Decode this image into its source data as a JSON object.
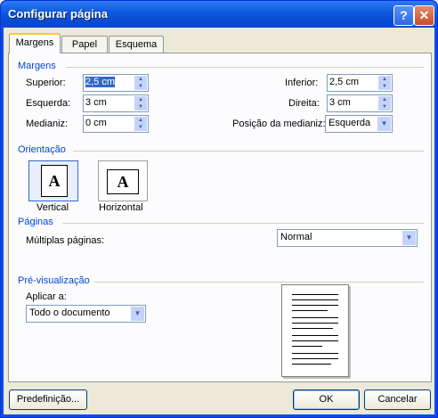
{
  "window": {
    "title": "Configurar página",
    "help_glyph": "?",
    "close_glyph": "✕"
  },
  "tabs": [
    {
      "label": "Margens",
      "active": true
    },
    {
      "label": "Papel",
      "active": false
    },
    {
      "label": "Esquema",
      "active": false
    }
  ],
  "margins": {
    "group_label": "Margens",
    "superior": {
      "label": "Superior:",
      "value": "2,5 cm"
    },
    "esquerda": {
      "label": "Esquerda:",
      "value": "3 cm"
    },
    "medianiz": {
      "label": "Medianiz:",
      "value": "0 cm"
    },
    "inferior": {
      "label": "Inferior:",
      "value": "2,5 cm"
    },
    "direita": {
      "label": "Direita:",
      "value": "3 cm"
    },
    "posicao": {
      "label": "Posição da medianiz:",
      "value": "Esquerda"
    }
  },
  "orientation": {
    "group_label": "Orientação",
    "vertical": {
      "label": "Vertical",
      "glyph": "A"
    },
    "horizontal": {
      "label": "Horizontal",
      "glyph": "A"
    }
  },
  "pages": {
    "group_label": "Páginas",
    "multiple_label": "Múltiplas páginas:",
    "multiple_value": "Normal"
  },
  "preview": {
    "group_label": "Pré-visualização",
    "apply_label": "Aplicar a:",
    "apply_value": "Todo o documento"
  },
  "buttons": {
    "default": "Predefinição...",
    "ok": "OK",
    "cancel": "Cancelar"
  },
  "colors": {
    "titlebar": "#0a59dd",
    "group_text": "#0046d5",
    "selection": "#316ac5",
    "face": "#ece9d8"
  }
}
